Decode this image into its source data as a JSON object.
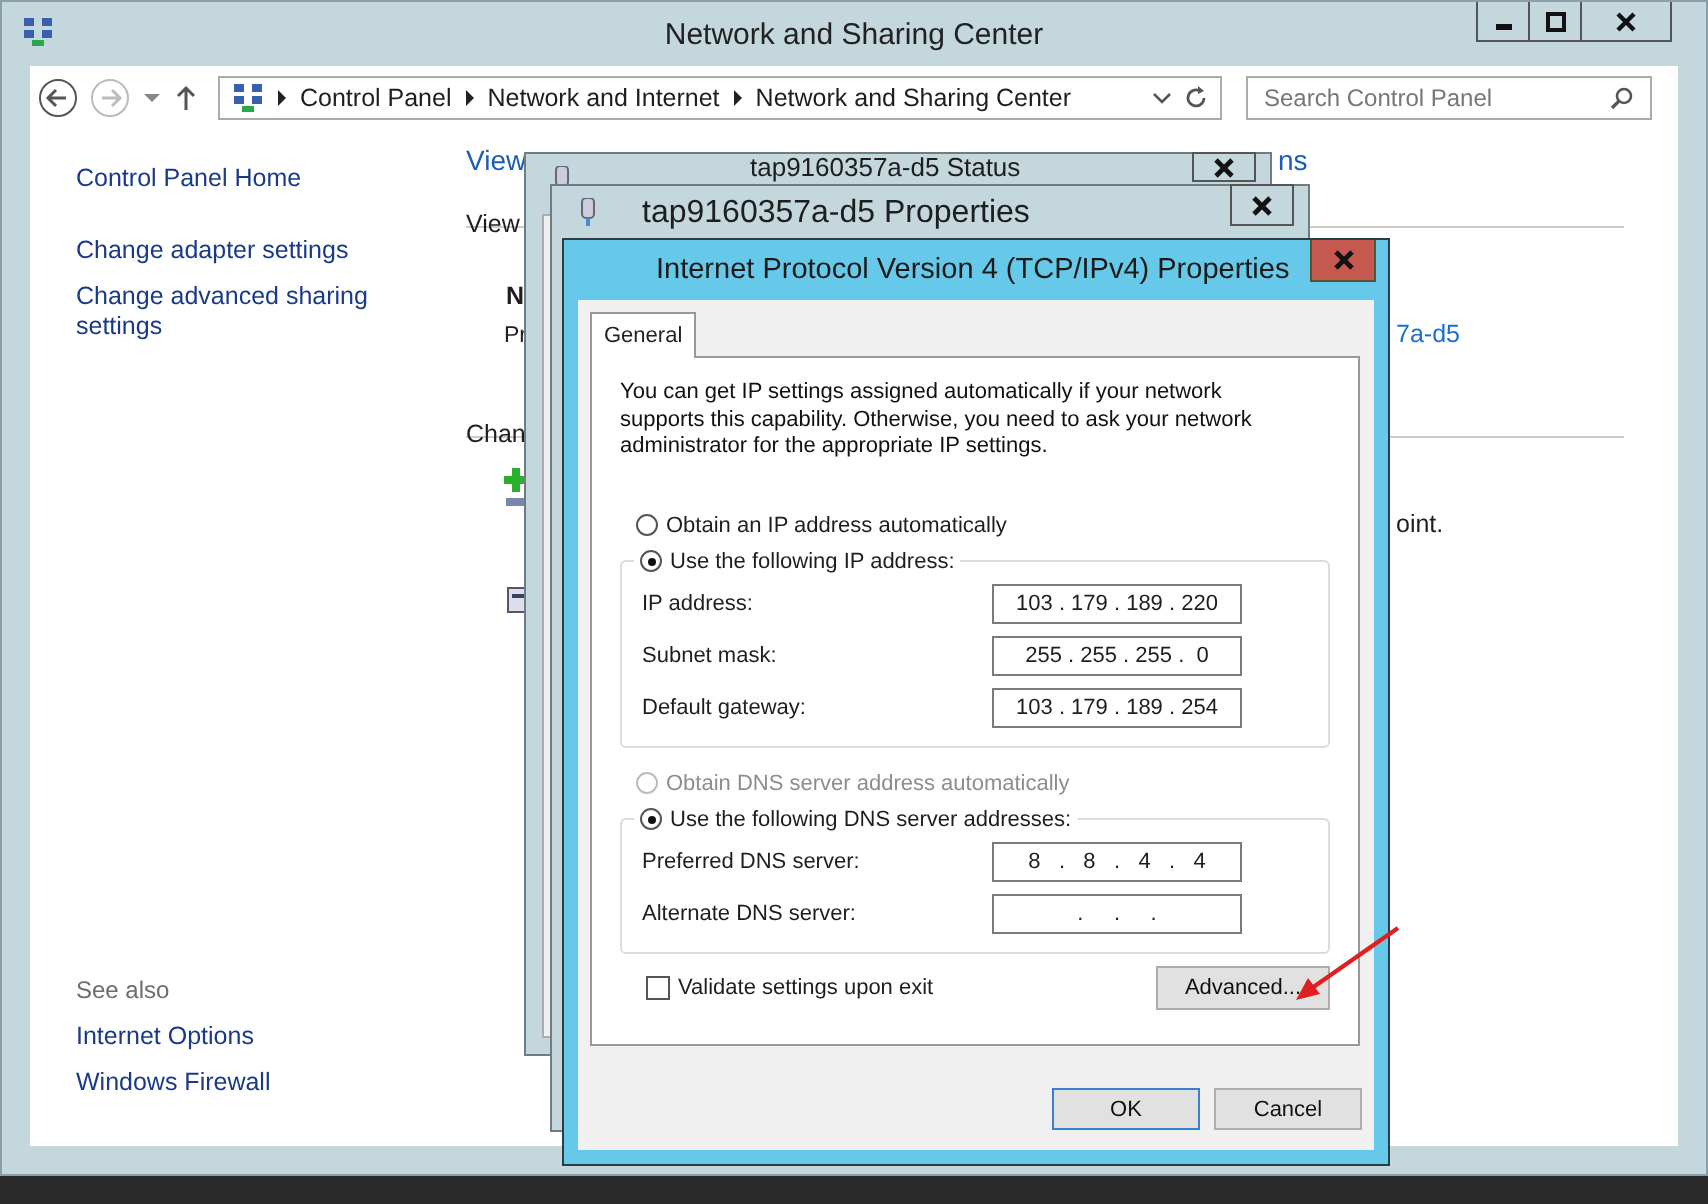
{
  "window": {
    "title": "Network and Sharing Center"
  },
  "address_bar": {
    "crumbs": [
      "Control Panel",
      "Network and Internet",
      "Network and Sharing Center"
    ]
  },
  "search": {
    "placeholder": "Search Control Panel"
  },
  "sidebar": {
    "items": [
      "Control Panel Home",
      "Change adapter settings",
      "Change advanced sharing settings"
    ],
    "see_also_heading": "See also",
    "see_also": [
      "Internet Options",
      "Windows Firewall"
    ]
  },
  "background_fragments": [
    {
      "text": "View",
      "kind": "heading"
    },
    {
      "text": "ns",
      "kind": "heading"
    },
    {
      "text": "View",
      "kind": "text"
    },
    {
      "text": "N",
      "kind": "bold"
    },
    {
      "text": "Pr",
      "kind": "text"
    },
    {
      "text": "7a-d5",
      "kind": "link"
    },
    {
      "text": "Chan",
      "kind": "text"
    },
    {
      "text": "oint.",
      "kind": "text"
    }
  ],
  "status_window": {
    "title": "tap9160357a-d5 Status"
  },
  "properties_window": {
    "title": "tap9160357a-d5 Properties"
  },
  "ipv4_dialog": {
    "title": "Internet Protocol Version 4 (TCP/IPv4) Properties",
    "tabs": [
      {
        "label": "General",
        "selected": true
      }
    ],
    "description": "You can get IP settings assigned automatically if your network supports this capability. Otherwise, you need to ask your network administrator for the appropriate IP settings.",
    "ip_mode": [
      {
        "label": "Obtain an IP address automatically",
        "selected": false,
        "disabled": false
      },
      {
        "label": "Use the following IP address:",
        "selected": true,
        "disabled": false
      }
    ],
    "ip_fields": [
      {
        "label": "IP address:",
        "value": "103 . 179 . 189 . 220"
      },
      {
        "label": "Subnet mask:",
        "value": "255 . 255 . 255 .  0"
      },
      {
        "label": "Default gateway:",
        "value": "103 . 179 . 189 . 254"
      }
    ],
    "dns_mode": [
      {
        "label": "Obtain DNS server address automatically",
        "selected": false,
        "disabled": true
      },
      {
        "label": "Use the following DNS server addresses:",
        "selected": true,
        "disabled": false
      }
    ],
    "dns_fields": [
      {
        "label": "Preferred DNS server:",
        "value": "8   .   8   .   4   .   4"
      },
      {
        "label": "Alternate DNS server:",
        "value": ".     .     ."
      }
    ],
    "validate_checkbox": {
      "label": "Validate settings upon exit",
      "checked": false
    },
    "advanced_button": "Advanced...",
    "buttons": [
      {
        "label": "OK",
        "default": true
      },
      {
        "label": "Cancel",
        "default": false
      }
    ]
  }
}
